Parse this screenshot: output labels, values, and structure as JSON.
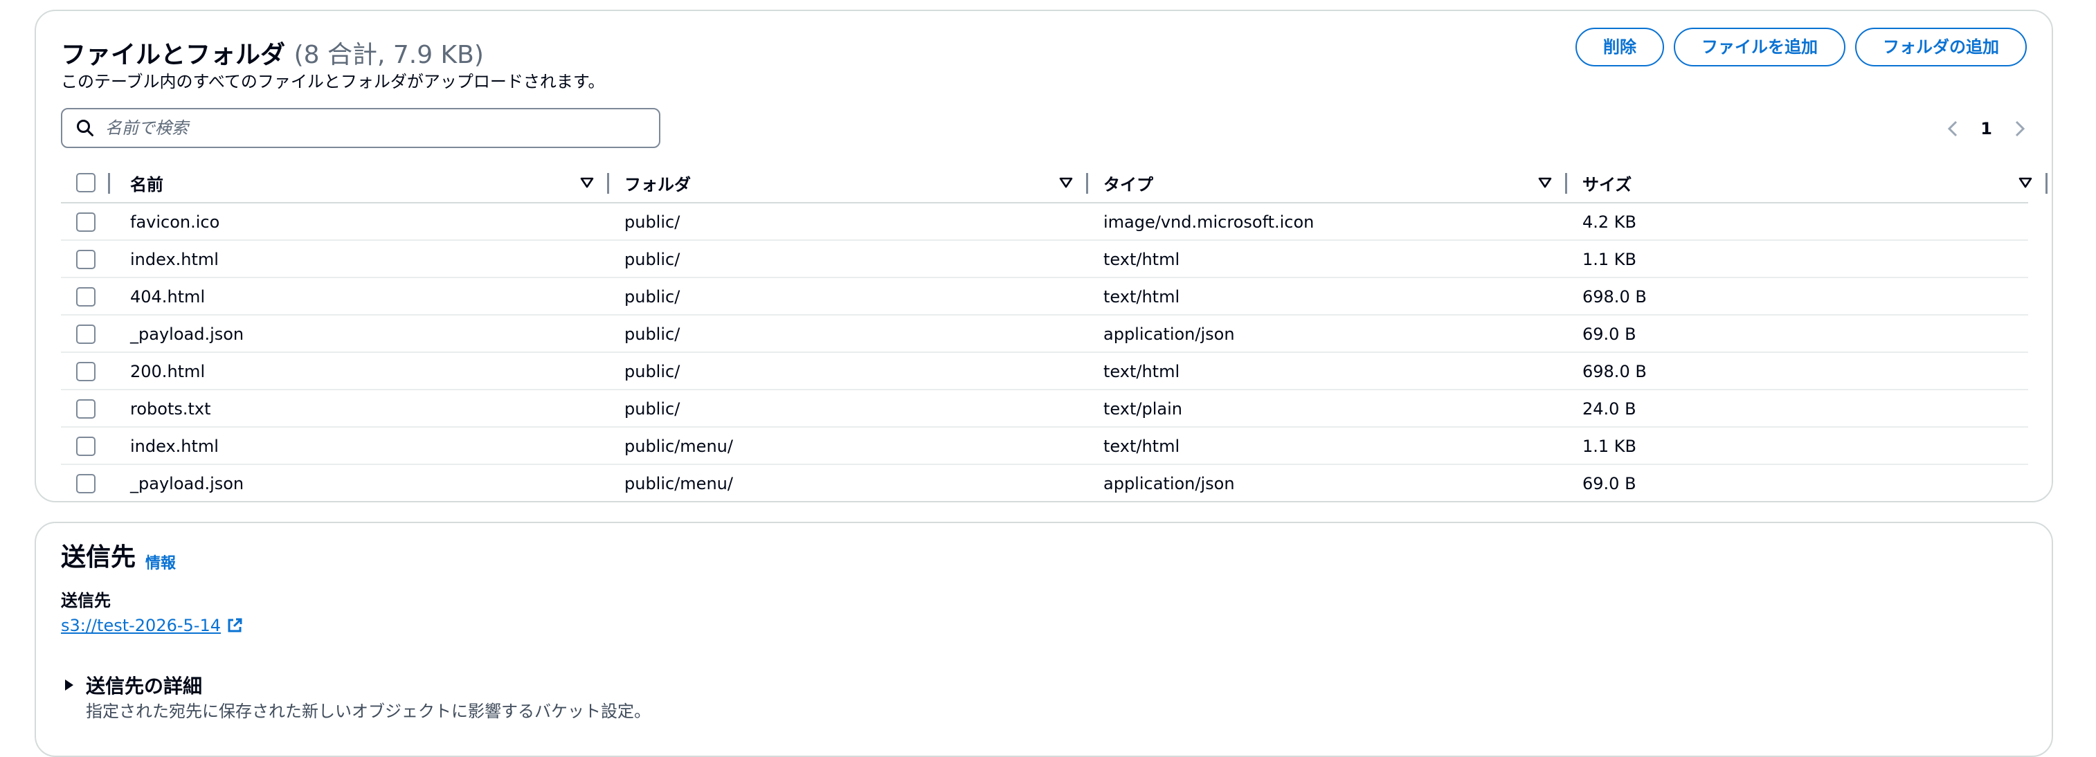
{
  "files_panel": {
    "title": "ファイルとフォルダ",
    "count": "(8 合計, 7.9 KB)",
    "description": "このテーブル内のすべてのファイルとフォルダがアップロードされます。",
    "buttons": {
      "delete": "削除",
      "add_files": "ファイルを追加",
      "add_folder": "フォルダの追加"
    },
    "search": {
      "placeholder": "名前で検索",
      "value": ""
    },
    "pagination": {
      "current_page": "1"
    },
    "table": {
      "columns": [
        "名前",
        "フォルダ",
        "タイプ",
        "サイズ"
      ],
      "rows": [
        {
          "name": "favicon.ico",
          "folder": "public/",
          "type": "image/vnd.microsoft.icon",
          "size": "4.2 KB"
        },
        {
          "name": "index.html",
          "folder": "public/",
          "type": "text/html",
          "size": "1.1 KB"
        },
        {
          "name": "404.html",
          "folder": "public/",
          "type": "text/html",
          "size": "698.0 B"
        },
        {
          "name": "_payload.json",
          "folder": "public/",
          "type": "application/json",
          "size": "69.0 B"
        },
        {
          "name": "200.html",
          "folder": "public/",
          "type": "text/html",
          "size": "698.0 B"
        },
        {
          "name": "robots.txt",
          "folder": "public/",
          "type": "text/plain",
          "size": "24.0 B"
        },
        {
          "name": "index.html",
          "folder": "public/menu/",
          "type": "text/html",
          "size": "1.1 KB"
        },
        {
          "name": "_payload.json",
          "folder": "public/menu/",
          "type": "application/json",
          "size": "69.0 B"
        }
      ]
    }
  },
  "destination_panel": {
    "title": "送信先",
    "info_link": "情報",
    "label": "送信先",
    "bucket_link": "s3://test-2026-5-14",
    "details_toggle": "送信先の詳細",
    "details_description": "指定された宛先に保存された新しいオブジェクトに影響するバケット設定。"
  },
  "colors": {
    "accent": "#0972d3",
    "border": "#d5dbdb",
    "text": "#000716",
    "secondary_text": "#5f6b7a"
  },
  "icons": [
    "search-icon",
    "chevron-left-icon",
    "chevron-right-icon",
    "sort-icon",
    "external-link-icon",
    "caret-right-icon"
  ]
}
